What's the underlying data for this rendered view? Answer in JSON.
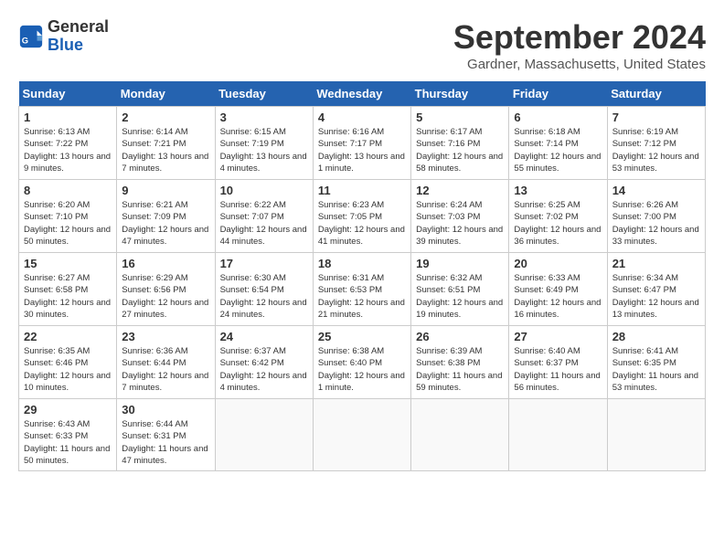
{
  "header": {
    "logo_line1": "General",
    "logo_line2": "Blue",
    "month": "September 2024",
    "location": "Gardner, Massachusetts, United States"
  },
  "weekdays": [
    "Sunday",
    "Monday",
    "Tuesday",
    "Wednesday",
    "Thursday",
    "Friday",
    "Saturday"
  ],
  "weeks": [
    [
      {
        "day": "1",
        "sunrise": "6:13 AM",
        "sunset": "7:22 PM",
        "daylight": "13 hours and 9 minutes."
      },
      {
        "day": "2",
        "sunrise": "6:14 AM",
        "sunset": "7:21 PM",
        "daylight": "13 hours and 7 minutes."
      },
      {
        "day": "3",
        "sunrise": "6:15 AM",
        "sunset": "7:19 PM",
        "daylight": "13 hours and 4 minutes."
      },
      {
        "day": "4",
        "sunrise": "6:16 AM",
        "sunset": "7:17 PM",
        "daylight": "13 hours and 1 minute."
      },
      {
        "day": "5",
        "sunrise": "6:17 AM",
        "sunset": "7:16 PM",
        "daylight": "12 hours and 58 minutes."
      },
      {
        "day": "6",
        "sunrise": "6:18 AM",
        "sunset": "7:14 PM",
        "daylight": "12 hours and 55 minutes."
      },
      {
        "day": "7",
        "sunrise": "6:19 AM",
        "sunset": "7:12 PM",
        "daylight": "12 hours and 53 minutes."
      }
    ],
    [
      {
        "day": "8",
        "sunrise": "6:20 AM",
        "sunset": "7:10 PM",
        "daylight": "12 hours and 50 minutes."
      },
      {
        "day": "9",
        "sunrise": "6:21 AM",
        "sunset": "7:09 PM",
        "daylight": "12 hours and 47 minutes."
      },
      {
        "day": "10",
        "sunrise": "6:22 AM",
        "sunset": "7:07 PM",
        "daylight": "12 hours and 44 minutes."
      },
      {
        "day": "11",
        "sunrise": "6:23 AM",
        "sunset": "7:05 PM",
        "daylight": "12 hours and 41 minutes."
      },
      {
        "day": "12",
        "sunrise": "6:24 AM",
        "sunset": "7:03 PM",
        "daylight": "12 hours and 39 minutes."
      },
      {
        "day": "13",
        "sunrise": "6:25 AM",
        "sunset": "7:02 PM",
        "daylight": "12 hours and 36 minutes."
      },
      {
        "day": "14",
        "sunrise": "6:26 AM",
        "sunset": "7:00 PM",
        "daylight": "12 hours and 33 minutes."
      }
    ],
    [
      {
        "day": "15",
        "sunrise": "6:27 AM",
        "sunset": "6:58 PM",
        "daylight": "12 hours and 30 minutes."
      },
      {
        "day": "16",
        "sunrise": "6:29 AM",
        "sunset": "6:56 PM",
        "daylight": "12 hours and 27 minutes."
      },
      {
        "day": "17",
        "sunrise": "6:30 AM",
        "sunset": "6:54 PM",
        "daylight": "12 hours and 24 minutes."
      },
      {
        "day": "18",
        "sunrise": "6:31 AM",
        "sunset": "6:53 PM",
        "daylight": "12 hours and 21 minutes."
      },
      {
        "day": "19",
        "sunrise": "6:32 AM",
        "sunset": "6:51 PM",
        "daylight": "12 hours and 19 minutes."
      },
      {
        "day": "20",
        "sunrise": "6:33 AM",
        "sunset": "6:49 PM",
        "daylight": "12 hours and 16 minutes."
      },
      {
        "day": "21",
        "sunrise": "6:34 AM",
        "sunset": "6:47 PM",
        "daylight": "12 hours and 13 minutes."
      }
    ],
    [
      {
        "day": "22",
        "sunrise": "6:35 AM",
        "sunset": "6:46 PM",
        "daylight": "12 hours and 10 minutes."
      },
      {
        "day": "23",
        "sunrise": "6:36 AM",
        "sunset": "6:44 PM",
        "daylight": "12 hours and 7 minutes."
      },
      {
        "day": "24",
        "sunrise": "6:37 AM",
        "sunset": "6:42 PM",
        "daylight": "12 hours and 4 minutes."
      },
      {
        "day": "25",
        "sunrise": "6:38 AM",
        "sunset": "6:40 PM",
        "daylight": "12 hours and 1 minute."
      },
      {
        "day": "26",
        "sunrise": "6:39 AM",
        "sunset": "6:38 PM",
        "daylight": "11 hours and 59 minutes."
      },
      {
        "day": "27",
        "sunrise": "6:40 AM",
        "sunset": "6:37 PM",
        "daylight": "11 hours and 56 minutes."
      },
      {
        "day": "28",
        "sunrise": "6:41 AM",
        "sunset": "6:35 PM",
        "daylight": "11 hours and 53 minutes."
      }
    ],
    [
      {
        "day": "29",
        "sunrise": "6:43 AM",
        "sunset": "6:33 PM",
        "daylight": "11 hours and 50 minutes."
      },
      {
        "day": "30",
        "sunrise": "6:44 AM",
        "sunset": "6:31 PM",
        "daylight": "11 hours and 47 minutes."
      },
      null,
      null,
      null,
      null,
      null
    ]
  ]
}
